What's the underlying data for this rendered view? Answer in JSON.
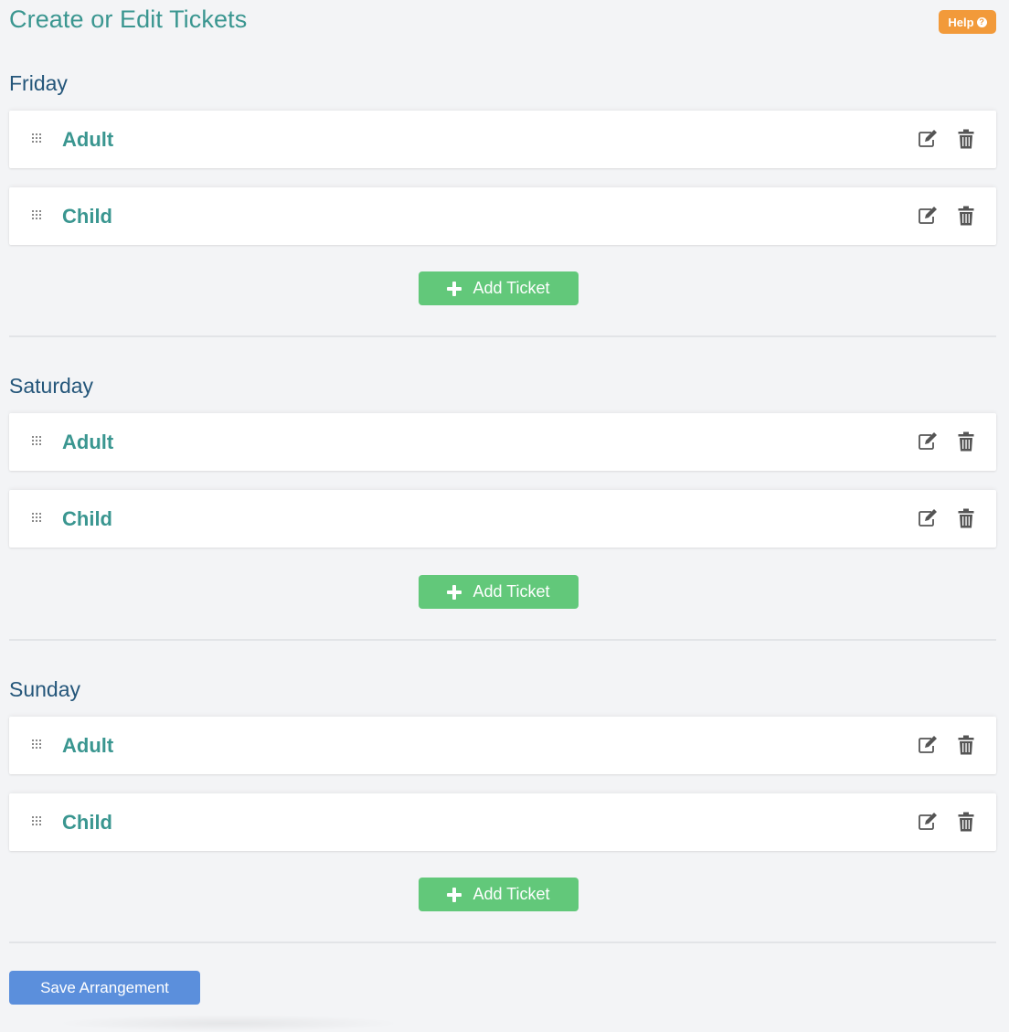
{
  "page": {
    "title": "Create or Edit Tickets",
    "help_label": "Help",
    "help_icon": "question-circle-icon",
    "save_label": "Save Arrangement"
  },
  "colors": {
    "accent_teal": "#3a9690",
    "heading_blue": "#24567a",
    "help_orange": "#f29a3a",
    "add_green": "#62c87a",
    "save_blue": "#5b8fdc"
  },
  "icons": {
    "drag": "drag-handle-icon",
    "edit": "edit-icon",
    "delete": "trash-icon",
    "add": "plus-icon"
  },
  "days": [
    {
      "name": "Friday",
      "tickets": [
        {
          "name": "Adult"
        },
        {
          "name": "Child"
        }
      ],
      "add_label": "Add Ticket"
    },
    {
      "name": "Saturday",
      "tickets": [
        {
          "name": "Adult"
        },
        {
          "name": "Child"
        }
      ],
      "add_label": "Add Ticket"
    },
    {
      "name": "Sunday",
      "tickets": [
        {
          "name": "Adult"
        },
        {
          "name": "Child"
        }
      ],
      "add_label": "Add Ticket"
    }
  ]
}
